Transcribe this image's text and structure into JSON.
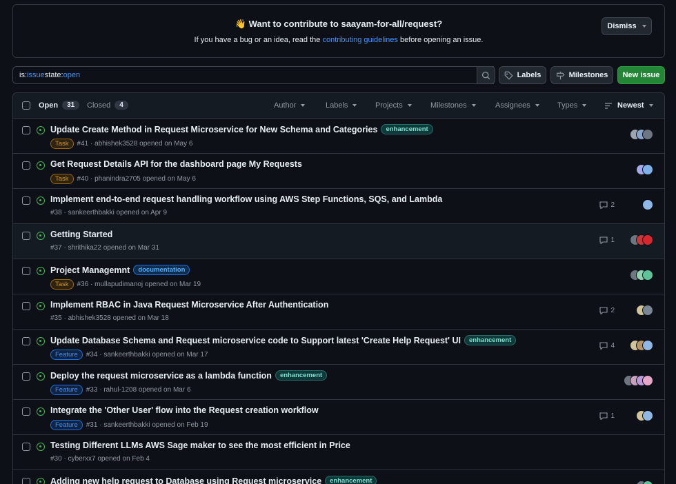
{
  "banner": {
    "title": "👋 Want to contribute to saayam-for-all/request?",
    "sub_prefix": "If you have a bug or an idea, read the ",
    "sub_link": "contributing guidelines",
    "sub_suffix": " before opening an issue.",
    "dismiss_label": "Dismiss"
  },
  "search": {
    "q1_key": "is:",
    "q1_val": "issue",
    "q2_key": " state:",
    "q2_val": "open"
  },
  "toolbar": {
    "labels_label": "Labels",
    "milestones_label": "Milestones",
    "new_issue_label": "New issue"
  },
  "tabs": {
    "open_label": "Open",
    "open_count": "31",
    "closed_label": "Closed",
    "closed_count": "4"
  },
  "filters": {
    "author": "Author",
    "labels": "Labels",
    "projects": "Projects",
    "milestones": "Milestones",
    "assignees": "Assignees",
    "types": "Types",
    "sort": "Newest"
  },
  "colors": {
    "accent": "#4493f8",
    "open_green": "#3fb950",
    "primary_button": "#238636"
  },
  "issues": [
    {
      "title": "Update Create Method in Request Microservice for New Schema and Categories",
      "label": "enhancement",
      "type": "Task",
      "meta": "#41 · abhishek3528 opened on May 6",
      "comments": ""
    },
    {
      "title": "Get Request Details API for the dashboard page My Requests",
      "label": "",
      "type": "Task",
      "meta": "#40 · phanindra2705 opened on May 6",
      "comments": ""
    },
    {
      "title": "Implement end-to-end request handling workflow using AWS Step Functions, SQS, and Lambda",
      "label": "",
      "type": "",
      "meta": "#38 · sankeerthbakki opened on Apr 9",
      "comments": "2"
    },
    {
      "title": "Getting Started",
      "label": "",
      "type": "",
      "meta": "#37 · shrithika22 opened on Mar 31",
      "comments": "1"
    },
    {
      "title": "Project Managemnt",
      "label": "documentation",
      "type": "Task",
      "meta": "#36 · mullapudimanoj opened on Mar 19",
      "comments": ""
    },
    {
      "title": "Implement RBAC in Java Request Microservice After Authentication",
      "label": "",
      "type": "",
      "meta": "#35 · abhishek3528 opened on Mar 18",
      "comments": "2"
    },
    {
      "title": "Update Database Schema and Request microservice code to Support latest 'Create Help Request' UI",
      "label": "enhancement",
      "type": "Feature",
      "meta": "#34 · sankeerthbakki opened on Mar 17",
      "comments": "4"
    },
    {
      "title": "Deploy the request microservice as a lambda function",
      "label": "enhancement",
      "type": "Feature",
      "meta": "#33 · rahul-1208 opened on Mar 6",
      "comments": ""
    },
    {
      "title": "Integrate the 'Other User' flow into the Request creation workflow",
      "label": "",
      "type": "Feature",
      "meta": "#31 · sankeerthbakki opened on Feb 19",
      "comments": "1"
    },
    {
      "title": "Testing Different LLMs AWS Sage maker to see the most efficient in Price",
      "label": "",
      "type": "",
      "meta": "#30 · cyberxx7 opened on Feb 4",
      "comments": ""
    },
    {
      "title": "Adding new help request to Database using Request microservice",
      "label": "enhancement",
      "type": "",
      "meta": "",
      "comments": ""
    }
  ]
}
